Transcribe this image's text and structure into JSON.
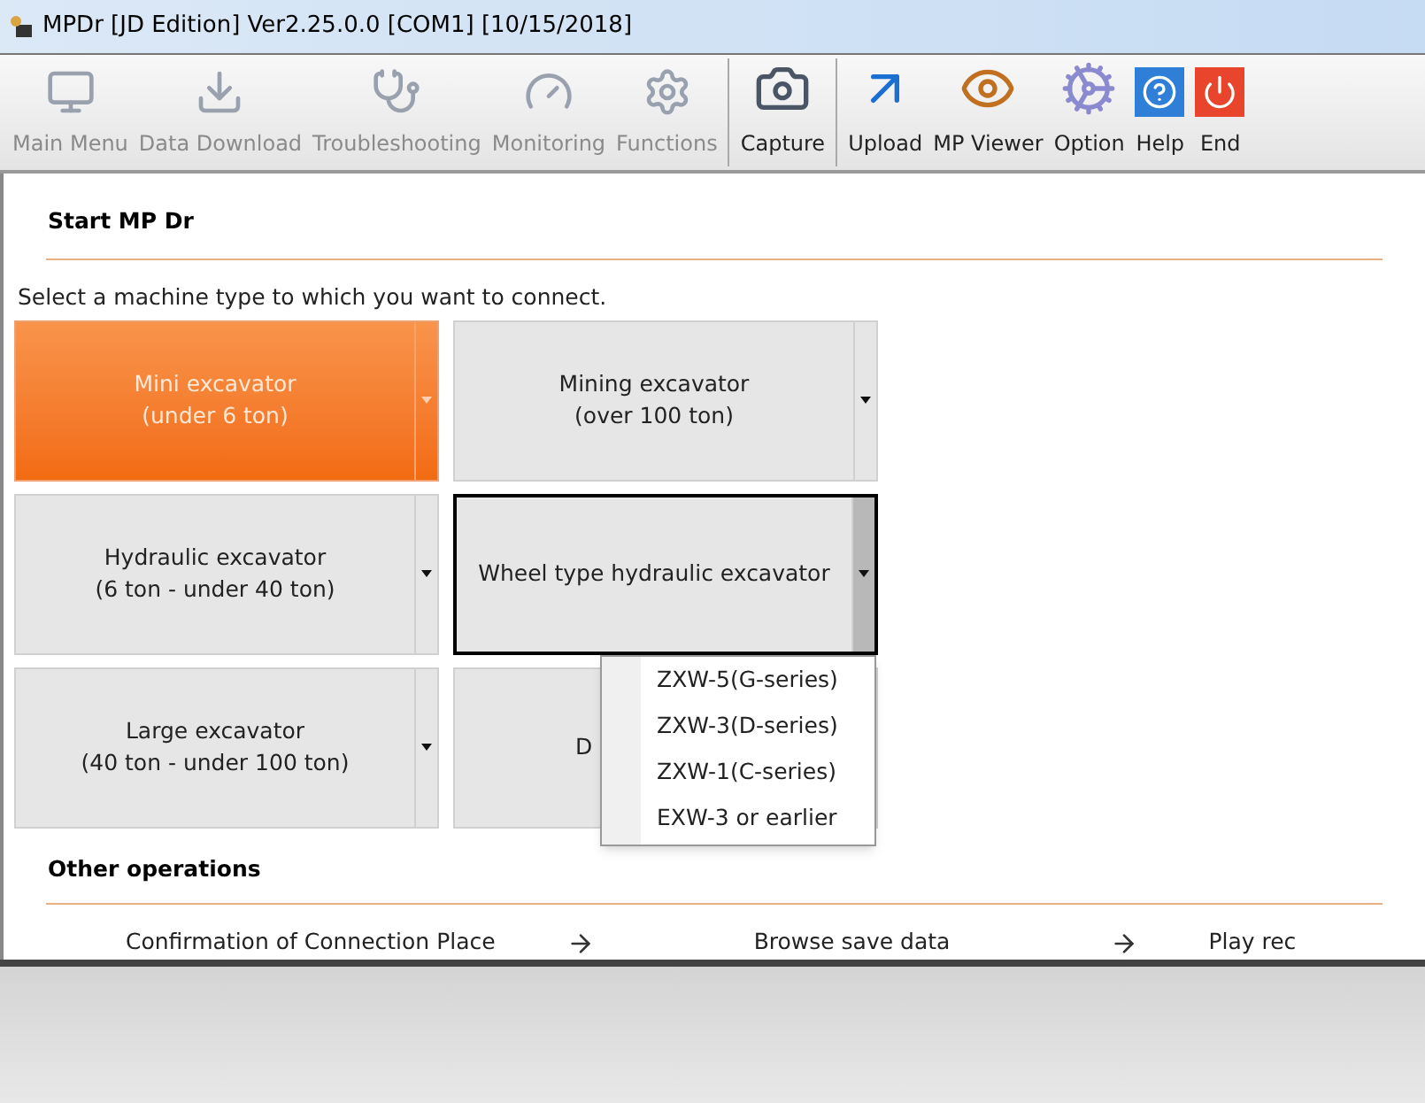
{
  "window": {
    "title": "MPDr [JD Edition] Ver2.25.0.0 [COM1] [10/15/2018]"
  },
  "toolbar": [
    {
      "label": "Main Menu",
      "disabled": true
    },
    {
      "label": "Data Download",
      "disabled": true
    },
    {
      "label": "Troubleshooting",
      "disabled": true
    },
    {
      "label": "Monitoring",
      "disabled": true
    },
    {
      "label": "Functions",
      "disabled": true
    },
    {
      "label": "Capture",
      "disabled": false
    },
    {
      "label": "Upload",
      "disabled": false
    },
    {
      "label": "MP Viewer",
      "disabled": false
    },
    {
      "label": "Option",
      "disabled": false
    },
    {
      "label": "Help",
      "disabled": false
    },
    {
      "label": "End",
      "disabled": false
    }
  ],
  "start_section": {
    "title": "Start MP Dr",
    "instruction": "Select a machine type to which you want to connect.",
    "machines": [
      {
        "lines": [
          "Mini excavator",
          "(under 6 ton)"
        ],
        "selected": true,
        "expanded": false
      },
      {
        "lines": [
          "Mining excavator",
          "(over 100 ton)"
        ],
        "selected": false,
        "expanded": false
      },
      {
        "lines": [
          "Hydraulic excavator",
          "(6 ton - under 40 ton)"
        ],
        "selected": false,
        "expanded": false
      },
      {
        "lines": [
          "Wheel type hydraulic excavator"
        ],
        "selected": false,
        "expanded": true,
        "menu": [
          "ZXW-5(G-series)",
          "ZXW-3(D-series)",
          "ZXW-1(C-series)",
          "EXW-3 or earlier"
        ]
      },
      {
        "lines": [
          "Large excavator",
          "(40 ton - under 100 ton)"
        ],
        "selected": false,
        "expanded": false
      },
      {
        "lines": [
          "D"
        ],
        "selected": false,
        "expanded": false
      }
    ]
  },
  "other_section": {
    "title": "Other operations",
    "items": [
      "Confirmation of Connection Place",
      "Browse save data",
      "Play rec"
    ]
  }
}
